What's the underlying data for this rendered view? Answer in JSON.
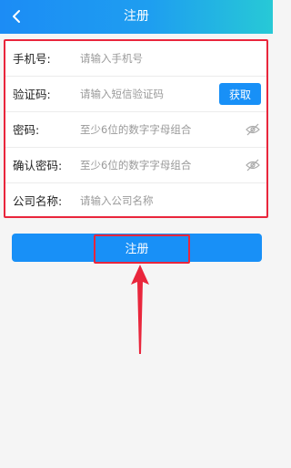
{
  "header": {
    "title": "注册"
  },
  "form": {
    "phone": {
      "label": "手机号:",
      "placeholder": "请输入手机号"
    },
    "code": {
      "label": "验证码:",
      "placeholder": "请输入短信验证码",
      "button": "获取"
    },
    "password": {
      "label": "密码:",
      "placeholder": "至少6位的数字字母组合"
    },
    "confirm": {
      "label": "确认密码:",
      "placeholder": "至少6位的数字字母组合"
    },
    "company": {
      "label": "公司名称:",
      "placeholder": "请输入公司名称"
    }
  },
  "submit_label": "注册",
  "colors": {
    "accent": "#1890f7",
    "highlight": "#e9263c",
    "header_gradient_end": "#27c9d6"
  },
  "icons": {
    "back": "chevron-left-icon",
    "password_toggle": "eye-closed-icon"
  }
}
